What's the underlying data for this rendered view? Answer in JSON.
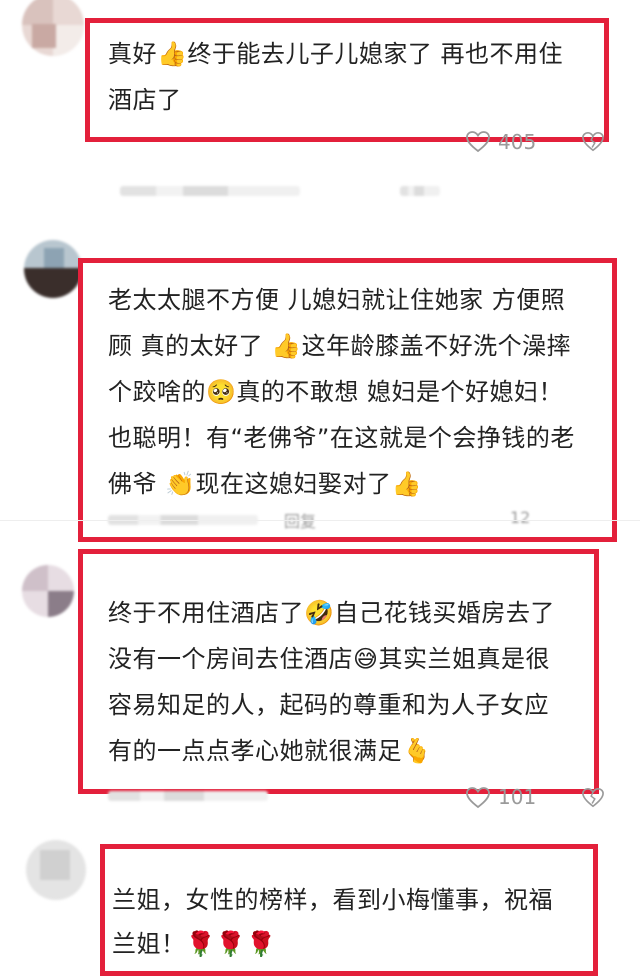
{
  "comments": [
    {
      "text_line1": "真好👍终于能去儿子儿媳家了 再也不用住",
      "text_line2": "酒店了",
      "like_count": "405"
    },
    {
      "text_line1": "老太太腿不方便 儿媳妇就让住她家 方便照",
      "text_line2": "顾 真的太好了 👍这年龄膝盖不好洗个澡摔",
      "text_line3": "个跤啥的🥺真的不敢想 媳妇是个好媳妇！",
      "text_line4": "也聪明！有“老佛爷”在这就是个会挣钱的老",
      "text_line5": "佛爷 👏现在这媳妇娶对了👍",
      "meta_label": "回复",
      "like_count": "12"
    },
    {
      "text_line1": "终于不用住酒店了🤣自己花钱买婚房去了",
      "text_line2": "没有一个房间去住酒店😅其实兰姐真是很",
      "text_line3": "容易知足的人，起码的尊重和为人子女应",
      "text_line4": "有的一点点孝心她就很满足🫰",
      "like_count": "101"
    },
    {
      "text_line1": "兰姐，女性的榜样，看到小梅懂事，祝福",
      "text_line2": "兰姐！🌹🌹🌹"
    }
  ],
  "icons": {
    "like": "heart-outline-icon",
    "dislike": "dislike-icon"
  },
  "colors": {
    "highlight_border": "#e3203b",
    "meta_text": "#9a9a9a"
  }
}
